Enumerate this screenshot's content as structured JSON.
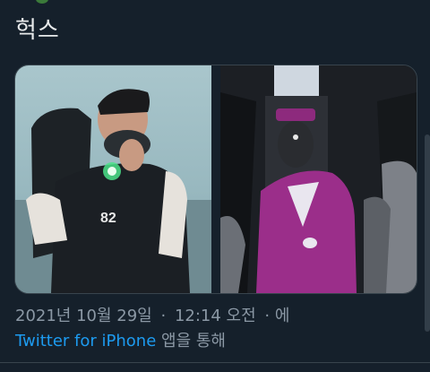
{
  "tweet": {
    "text": "헉스",
    "media": [
      {
        "kind": "photo",
        "name": "left-photo-man-with-gas-mask"
      },
      {
        "kind": "photo",
        "name": "right-photo-purple-uniform-gas-mask"
      }
    ],
    "photo_jersey_text": "82",
    "timestamp": {
      "date": "2021년 10월 29일",
      "separator": "·",
      "time": "12:14 오전",
      "trailing": "· 에"
    },
    "source": {
      "app_link": "Twitter for iPhone",
      "suffix": "앱을 통해"
    }
  },
  "colors": {
    "background": "#15202b",
    "text": "#e7e9ea",
    "muted": "#8b98a5",
    "link": "#1d9bf0",
    "border": "#38444d"
  }
}
